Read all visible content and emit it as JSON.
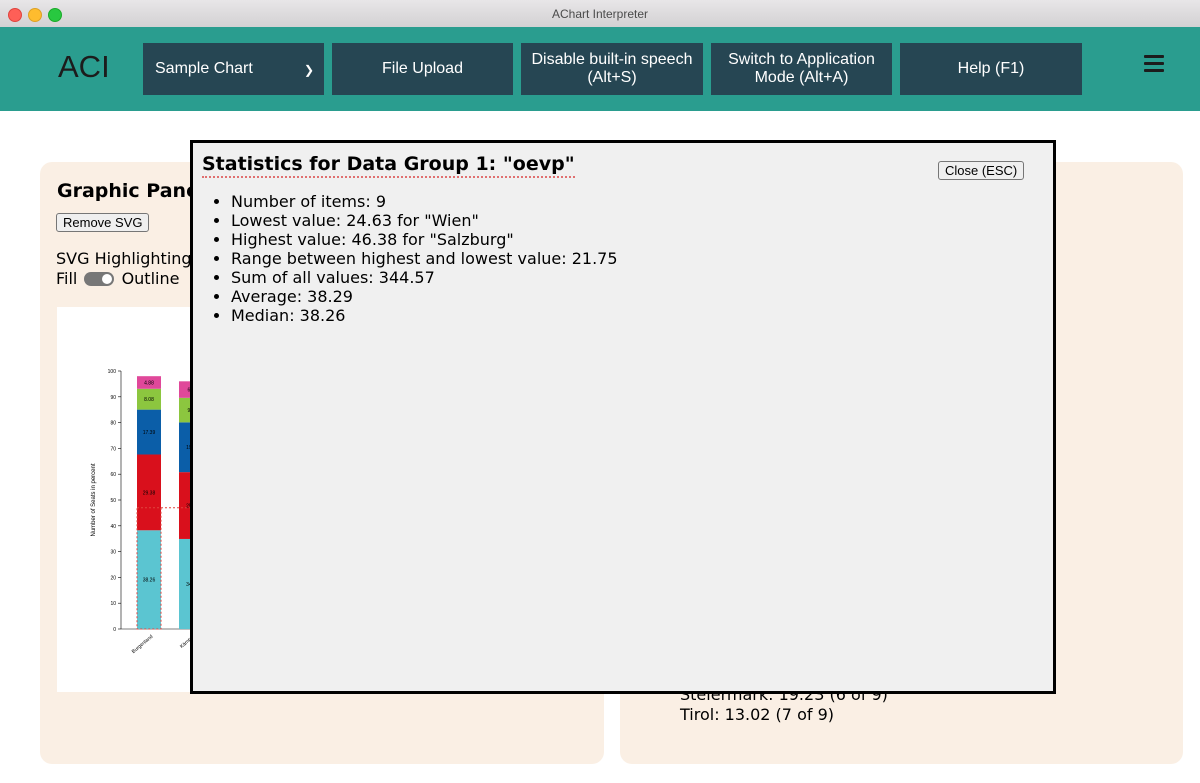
{
  "window": {
    "title": "AChart Interpreter"
  },
  "header": {
    "logo": "ACI",
    "chart_select": "Sample Chart",
    "file_upload": "File Upload",
    "speech_line1": "Disable built-in speech",
    "speech_line2": "(Alt+S)",
    "mode_line1": "Switch to Application",
    "mode_line2": "Mode (Alt+A)",
    "help": "Help (F1)"
  },
  "graphic_panel": {
    "title": "Graphic Panel",
    "remove_svg": "Remove SVG",
    "highlighting_label": "SVG Highlighting",
    "fill_label": "Fill",
    "outline_label": "Outline"
  },
  "right_panel": {
    "lines": [
      "Steiermark: 19.23 (6 of 9)",
      "Tirol: 13.02 (7 of 9)"
    ]
  },
  "modal": {
    "title": "Statistics for Data Group 1: \"oevp\"",
    "close": "Close (ESC)",
    "stats": [
      "Number of items: 9",
      "Lowest value: 24.63 for \"Wien\"",
      "Highest value: 46.38 for \"Salzburg\"",
      "Range between highest and lowest value: 21.75",
      "Sum of all values: 344.57",
      "Average: 38.29",
      "Median: 38.26"
    ]
  },
  "chart_data": {
    "type": "bar",
    "stacked": true,
    "ylabel": "Number of Seats in percent",
    "ylim": [
      0,
      100
    ],
    "yticks": [
      0,
      10,
      20,
      30,
      40,
      50,
      60,
      70,
      80,
      90,
      100
    ],
    "categories": [
      "Burgenland",
      "Kärnten"
    ],
    "reference_line": 47,
    "series": [
      {
        "color": "#5bc5d1",
        "values": [
          38.26,
          34.9
        ]
      },
      {
        "color": "#d9101c",
        "values": [
          29.38,
          25.9
        ]
      },
      {
        "color": "#0b5ea8",
        "values": [
          17.39,
          19.3
        ]
      },
      {
        "color": "#8cc63f",
        "values": [
          8.08,
          9.5
        ]
      },
      {
        "color": "#e0489a",
        "values": [
          4.88,
          6.4
        ]
      }
    ]
  }
}
